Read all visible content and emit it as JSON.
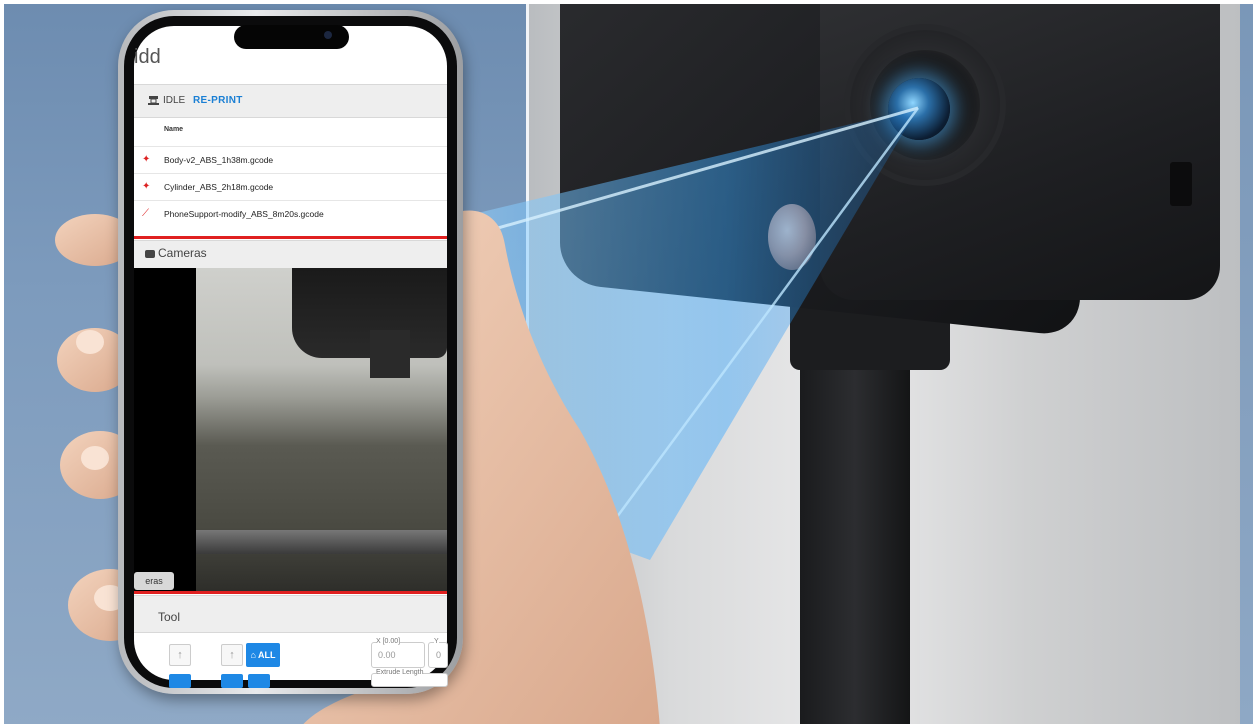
{
  "phone_app": {
    "title": "idd",
    "status": "IDLE",
    "reprint_label": "RE-PRINT",
    "files_header": "Name",
    "files": [
      {
        "name": "Body-v2_ABS_1h38m.gcode"
      },
      {
        "name": "Cylinder_ABS_2h18m.gcode"
      },
      {
        "name": "PhoneSupport-modify_ABS_8m20s.gcode"
      }
    ],
    "cameras_title": "Cameras",
    "cameras_button": "eras",
    "tool_title": "Tool",
    "home_all_label": "ALL",
    "x_label": "X [0.00]",
    "x_value": "0.00",
    "y_label": "Y",
    "y_value": "0",
    "extrude_label": "Extrude Length",
    "up_arrow": "↑",
    "home_icon": "⌂"
  },
  "colors": {
    "accent_red": "#e02020",
    "accent_blue": "#1e88e5",
    "beam_blue": "#3aa8ff"
  }
}
